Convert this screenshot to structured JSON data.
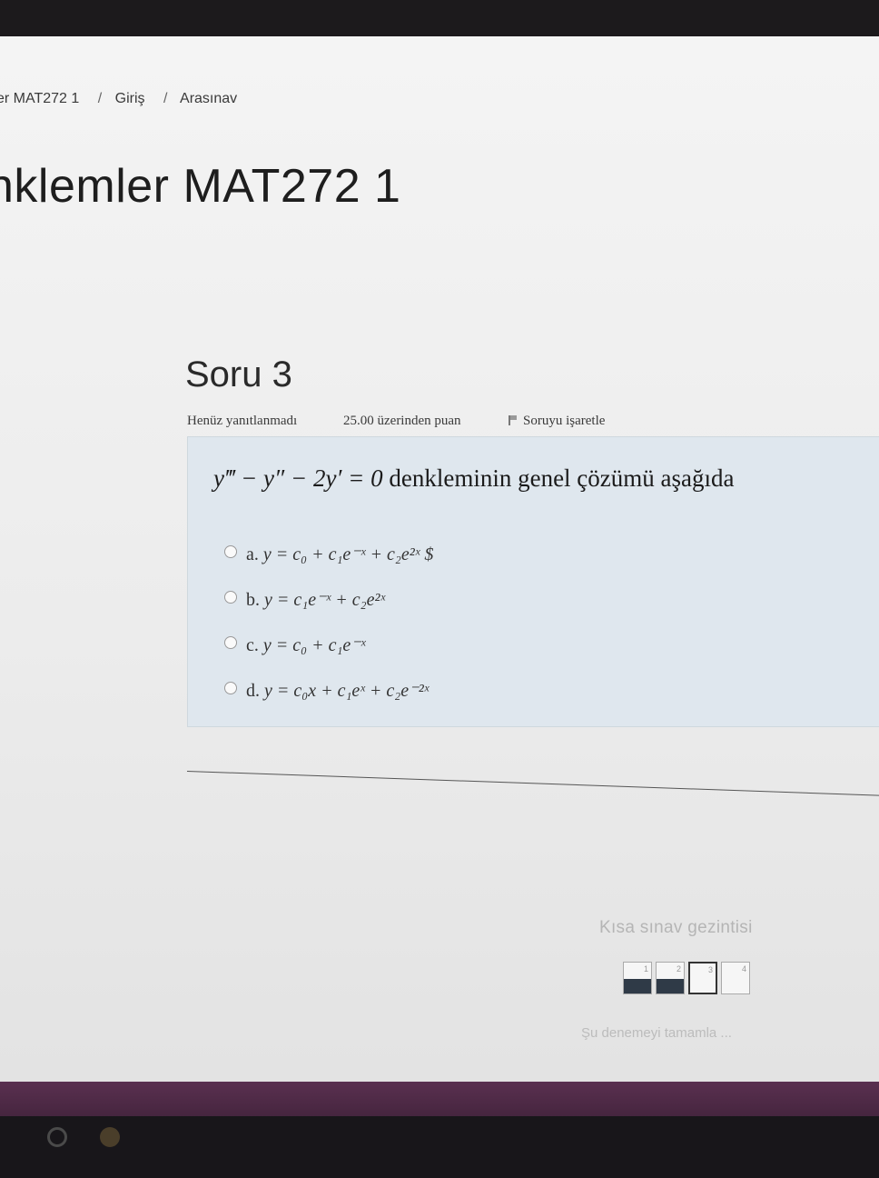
{
  "breadcrumb": {
    "items": [
      "er MAT272 1",
      "Giriş",
      "Arasınav"
    ],
    "separator": "/"
  },
  "page_title": "nklemler MAT272 1",
  "question": {
    "number": "Soru 3",
    "state": "Henüz yanıtlanmadı",
    "grade": "25.00 üzerinden puan",
    "flag_label": "Soruyu işaretle",
    "text_math": "y‴ − y″ − 2y′ = 0",
    "text_words": " denkleminin genel çözümü aşağıda",
    "answers": [
      {
        "letter": "a.",
        "text": "y = c₀ + c₁e⁻ˣ + c₂e²ˣ $"
      },
      {
        "letter": "b.",
        "text": "y = c₁e⁻ˣ + c₂e²ˣ"
      },
      {
        "letter": "c.",
        "text": "y = c₀ + c₁e⁻ˣ"
      },
      {
        "letter": "d.",
        "text": "y = c₀x + c₁eˣ + c₂e⁻²ˣ"
      }
    ]
  },
  "quiz_nav": {
    "title": "Kısa sınav gezintisi",
    "buttons": [
      {
        "label": "1",
        "state": "answered"
      },
      {
        "label": "2",
        "state": "answered"
      },
      {
        "label": "3",
        "state": "current"
      },
      {
        "label": "4",
        "state": "unanswered"
      }
    ],
    "finish_label": "Şu denemeyi tamamla ..."
  },
  "colors": {
    "question_box": "#dfe7ee",
    "band": "#5a3050"
  }
}
